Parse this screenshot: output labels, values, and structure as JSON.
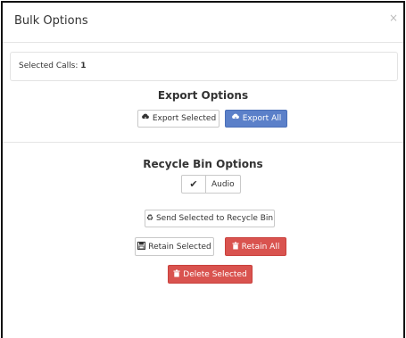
{
  "modal": {
    "title": "Bulk Options",
    "close_glyph": "×"
  },
  "selected": {
    "label": "Selected Calls:",
    "count": "1"
  },
  "export": {
    "title": "Export Options",
    "export_selected_label": "Export Selected",
    "export_all_label": "Export All",
    "icon": "cloud-download-icon"
  },
  "recycle": {
    "title": "Recycle Bin Options",
    "audio_toggle_label": "Audio",
    "audio_checked": true,
    "send_label": "Send Selected to Recycle Bin",
    "retain_selected_label": "Retain Selected",
    "retain_all_label": "Retain All",
    "delete_selected_label": "Delete Selected"
  },
  "colors": {
    "primary": "#5b80c9",
    "danger": "#d9534f"
  }
}
